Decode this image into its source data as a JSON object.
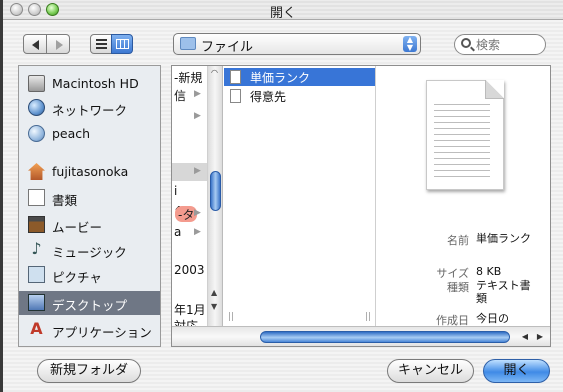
{
  "window": {
    "title": "開く"
  },
  "toolbar": {
    "path": "ファイル",
    "search_placeholder": "検索"
  },
  "sidebar": {
    "items": [
      {
        "label": "Macintosh HD",
        "icon": "hard-drive-icon"
      },
      {
        "label": "ネットワーク",
        "icon": "network-globe-icon"
      },
      {
        "label": "peach",
        "icon": "server-icon"
      },
      {
        "label": "fujitasonoka",
        "icon": "home-icon"
      },
      {
        "label": "書類",
        "icon": "documents-icon"
      },
      {
        "label": "ムービー",
        "icon": "movies-icon"
      },
      {
        "label": "ミュージック",
        "icon": "music-icon"
      },
      {
        "label": "ピクチャ",
        "icon": "pictures-icon"
      },
      {
        "label": "デスクトップ",
        "icon": "desktop-icon",
        "selected": true
      },
      {
        "label": "アプリケーション",
        "icon": "applications-icon"
      }
    ]
  },
  "column1": {
    "items": [
      {
        "text": "-新規"
      },
      {
        "text": "信"
      },
      {
        "text": ""
      },
      {
        "text": ""
      },
      {
        "text": ""
      },
      {
        "text": ""
      },
      {
        "text": ""
      },
      {
        "text": "-タ",
        "tag": true
      },
      {
        "text": "a"
      },
      {
        "text": ""
      },
      {
        "text": ""
      },
      {
        "text": "2003"
      },
      {
        "text": ""
      },
      {
        "text": ""
      },
      {
        "text": "年1月"
      },
      {
        "text": "対応"
      }
    ]
  },
  "column2": {
    "items": [
      {
        "label": "単価ランク",
        "selected": true
      },
      {
        "label": "得意先",
        "selected": false
      }
    ]
  },
  "preview": {
    "name_key": "名前",
    "name_value": "単価ランク",
    "size_key": "サイズ",
    "size_value": "8 KB",
    "kind_key": "種類",
    "kind_value": "テキスト書類",
    "created_key": "作成日",
    "created_value": "今日の"
  },
  "buttons": {
    "new_folder": "新規フォルダ",
    "cancel": "キャンセル",
    "open": "開く"
  },
  "colors": {
    "selection": "#3875d7",
    "sidebar_selected": "#6f7785",
    "default_button": "#3f8ae6"
  }
}
